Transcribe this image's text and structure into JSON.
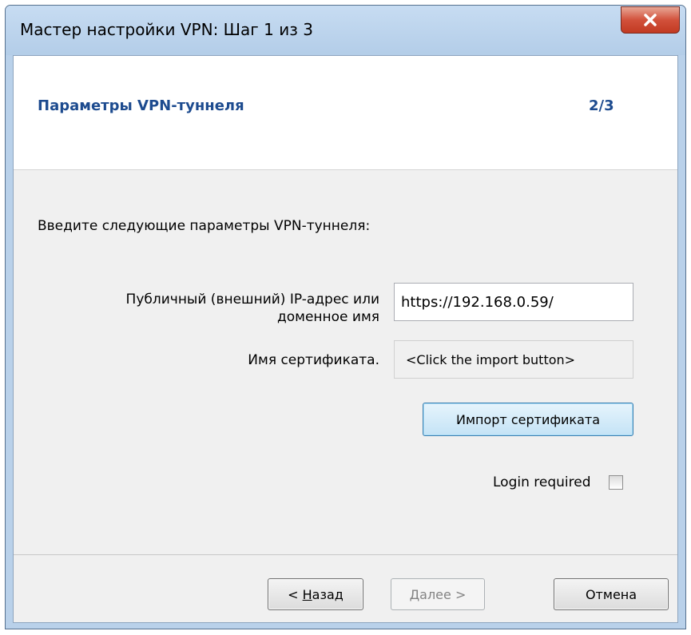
{
  "window": {
    "title": "Мастер настройки VPN: Шаг 1 из 3",
    "close_icon": "close-icon"
  },
  "header": {
    "title": "Параметры VPN-туннеля",
    "step": "2/3"
  },
  "form": {
    "intro": "Введите следующие параметры VPN-туннеля:",
    "ip_label_line1": "Публичный (внешний) IP-адрес или",
    "ip_label_line2": "доменное имя",
    "ip_value": "https://192.168.0.59/",
    "cert_label": "Имя сертификата.",
    "cert_value": "<Click the import button>",
    "import_button": "Импорт сертификата",
    "login_required_label": "Login required",
    "login_required_checked": false
  },
  "footer": {
    "back_prefix": "< ",
    "back_mnemonic": "Н",
    "back_rest": "азад",
    "next_mnemonic": "Д",
    "next_rest": "алее >",
    "cancel": "Отмена"
  },
  "colors": {
    "accent_title": "#1d4b8f",
    "default_button_border": "#3c7fb1",
    "close_button": "#c94a33"
  }
}
